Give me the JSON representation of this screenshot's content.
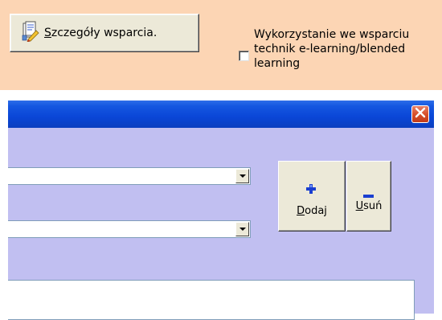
{
  "top": {
    "details_button": {
      "mnemonic": "S",
      "rest": "zczegóły wsparcia."
    },
    "elearning_checkbox": {
      "label": "Wykorzystanie we wsparciu technik e-learning/blended learning",
      "checked": false
    }
  },
  "window": {
    "dropdown_1": {
      "value": ""
    },
    "dropdown_2": {
      "value": ""
    },
    "add_button": {
      "mnemonic": "D",
      "rest": "odaj",
      "icon": "plus-icon"
    },
    "remove_button": {
      "mnemonic": "U",
      "rest": "suń",
      "icon": "minus-icon"
    },
    "notes": {
      "value": ""
    }
  },
  "colors": {
    "panel_bg": "#fcd5b4",
    "window_bg": "#c1bff1",
    "titlebar": "#0a46d7",
    "close_button": "#d8502a",
    "icon_blue": "#1a3fd0"
  }
}
